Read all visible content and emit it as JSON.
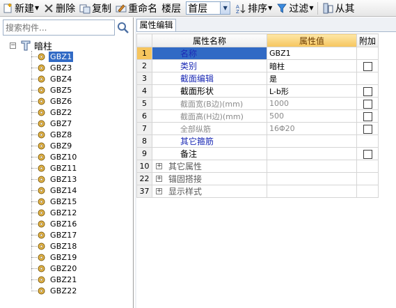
{
  "toolbar": {
    "new_label": "新建",
    "delete_label": "删除",
    "copy_label": "复制",
    "rename_label": "重命名",
    "floor_label": "楼层",
    "floor_value": "首层",
    "sort_label": "排序",
    "filter_label": "过滤",
    "from_label": "从其"
  },
  "search": {
    "placeholder": "搜索构件..."
  },
  "tree": {
    "root_label": "暗柱",
    "items": [
      "GBZ1",
      "GBZ3",
      "GBZ4",
      "GBZ5",
      "GBZ6",
      "GBZ2",
      "GBZ7",
      "GBZ8",
      "GBZ9",
      "GBZ10",
      "GBZ11",
      "GBZ13",
      "GBZ14",
      "GBZ15",
      "GBZ12",
      "GBZ16",
      "GBZ17",
      "GBZ18",
      "GBZ19",
      "GBZ20",
      "GBZ21",
      "GBZ22"
    ],
    "selected": "GBZ1"
  },
  "properties": {
    "tab_label": "属性编辑",
    "headers": {
      "name": "属性名称",
      "value": "属性值",
      "add": "附加"
    },
    "rows": [
      {
        "num": "1",
        "name": "名称",
        "value": "GBZ1"
      },
      {
        "num": "2",
        "name": "类别",
        "value": "暗柱"
      },
      {
        "num": "3",
        "name": "截面编辑",
        "value": "是"
      },
      {
        "num": "4",
        "name": "截面形状",
        "value": "L-b形"
      },
      {
        "num": "5",
        "name": "截面宽(B边)(mm)",
        "value": "1000"
      },
      {
        "num": "6",
        "name": "截面高(H边)(mm)",
        "value": "500"
      },
      {
        "num": "7",
        "name": "全部纵筋",
        "value": "16Φ20"
      },
      {
        "num": "8",
        "name": "其它箍筋",
        "value": ""
      },
      {
        "num": "9",
        "name": "备注",
        "value": ""
      }
    ],
    "groups": [
      {
        "num": "10",
        "label": "其它属性"
      },
      {
        "num": "22",
        "label": "锚固搭接"
      },
      {
        "num": "37",
        "label": "显示样式"
      }
    ]
  },
  "colors": {
    "selection": "#316ac5",
    "header_value": "#f6c55e",
    "blue_text": "#1c2bb5"
  }
}
